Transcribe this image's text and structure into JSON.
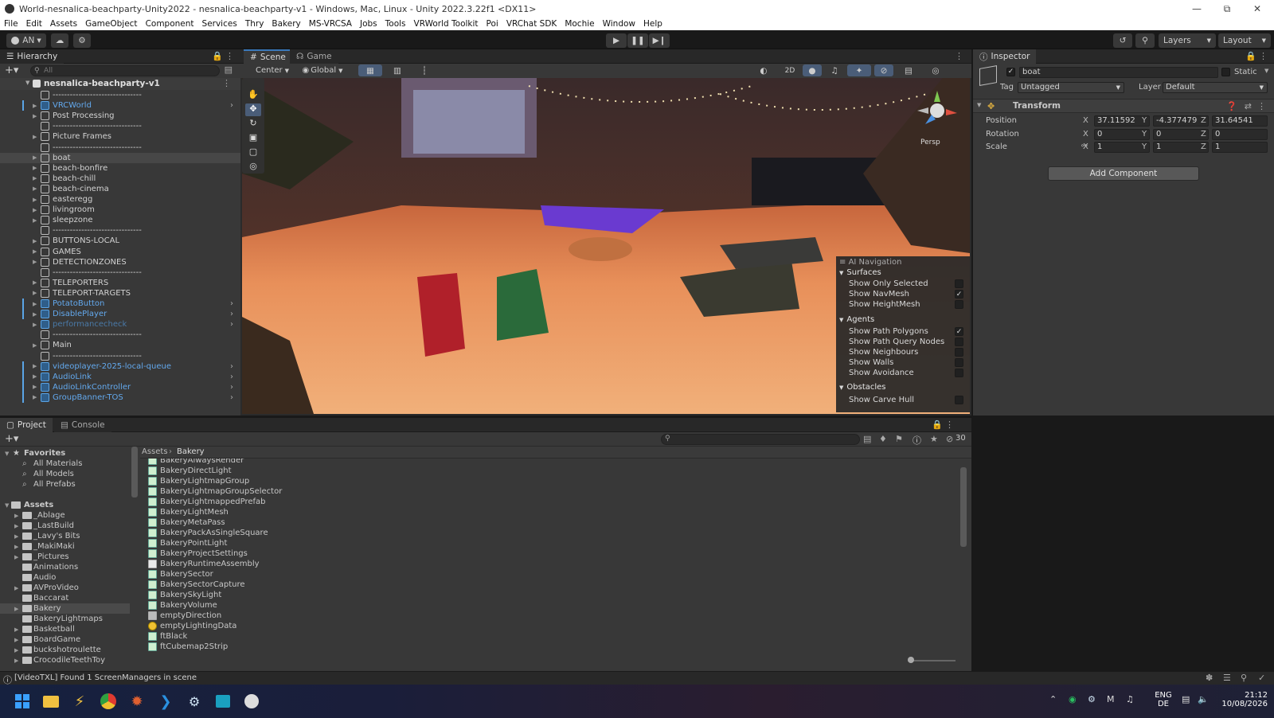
{
  "window": {
    "title": "World-nesnalica-beachparty-Unity2022 - nesnalica-beachparty-v1 - Windows, Mac, Linux - Unity 2022.3.22f1 <DX11>"
  },
  "menu": [
    "File",
    "Edit",
    "Assets",
    "GameObject",
    "Component",
    "Services",
    "Thry",
    "Bakery",
    "MS-VRCSA",
    "Jobs",
    "Tools",
    "VRWorld Toolkit",
    "Poi",
    "VRChat SDK",
    "Mochie",
    "Window",
    "Help"
  ],
  "toolbar": {
    "account": "AN",
    "layers": "Layers",
    "layout": "Layout"
  },
  "hierarchy": {
    "tab": "Hierarchy",
    "search_placeholder": "All",
    "scene_name": "nesnalica-beachparty-v1",
    "items": [
      {
        "label": "-------------------------------",
        "type": "sep"
      },
      {
        "label": "VRCWorld",
        "type": "prefab",
        "chev": true
      },
      {
        "label": "Post Processing",
        "type": "normal"
      },
      {
        "label": "-------------------------------",
        "type": "sep"
      },
      {
        "label": "Picture Frames",
        "type": "normal"
      },
      {
        "label": "-------------------------------",
        "type": "sep"
      },
      {
        "label": "boat",
        "type": "normal",
        "selected": true
      },
      {
        "label": "beach-bonfire",
        "type": "normal"
      },
      {
        "label": "beach-chill",
        "type": "normal"
      },
      {
        "label": "beach-cinema",
        "type": "normal"
      },
      {
        "label": "easteregg",
        "type": "normal"
      },
      {
        "label": "livingroom",
        "type": "normal"
      },
      {
        "label": "sleepzone",
        "type": "normal"
      },
      {
        "label": "-------------------------------",
        "type": "sep"
      },
      {
        "label": "BUTTONS-LOCAL",
        "type": "normal"
      },
      {
        "label": "GAMES",
        "type": "normal"
      },
      {
        "label": "DETECTIONZONES",
        "type": "normal"
      },
      {
        "label": "-------------------------------",
        "type": "sep"
      },
      {
        "label": "TELEPORTERS",
        "type": "normal"
      },
      {
        "label": "TELEPORT-TARGETS",
        "type": "normal"
      },
      {
        "label": "PotatoButton",
        "type": "prefab",
        "chev": true
      },
      {
        "label": "DisablePlayer",
        "type": "prefab",
        "chev": true
      },
      {
        "label": "performancecheck",
        "type": "faded",
        "chev": true
      },
      {
        "label": "-------------------------------",
        "type": "sep"
      },
      {
        "label": "Main",
        "type": "normal"
      },
      {
        "label": "-------------------------------",
        "type": "sep"
      },
      {
        "label": "videoplayer-2025-local-queue",
        "type": "prefab",
        "chev": true
      },
      {
        "label": "AudioLink",
        "type": "prefab",
        "chev": true
      },
      {
        "label": "AudioLinkController",
        "type": "prefab",
        "chev": true
      },
      {
        "label": "GroupBanner-TOS",
        "type": "prefab",
        "chev": true
      }
    ]
  },
  "scene": {
    "tabs": [
      "Scene",
      "Game"
    ],
    "pivot": "Center",
    "space": "Global",
    "mode2d": "2D",
    "gizmo_label": "Persp",
    "ai_nav": {
      "title": "AI Navigation",
      "surfaces": "Surfaces",
      "surface_opts": [
        {
          "label": "Show Only Selected",
          "checked": false
        },
        {
          "label": "Show NavMesh",
          "checked": true
        },
        {
          "label": "Show HeightMesh",
          "checked": false
        }
      ],
      "agents": "Agents",
      "agent_opts": [
        {
          "label": "Show Path Polygons",
          "checked": true
        },
        {
          "label": "Show Path Query Nodes",
          "checked": false
        },
        {
          "label": "Show Neighbours",
          "checked": false
        },
        {
          "label": "Show Walls",
          "checked": false
        },
        {
          "label": "Show Avoidance",
          "checked": false
        }
      ],
      "obstacles": "Obstacles",
      "obstacle_opts": [
        {
          "label": "Show Carve Hull",
          "checked": false
        }
      ]
    }
  },
  "inspector": {
    "tab": "Inspector",
    "object_name": "boat",
    "static_label": "Static",
    "tag_label": "Tag",
    "tag_value": "Untagged",
    "layer_label": "Layer",
    "layer_value": "Default",
    "component": "Transform",
    "position": {
      "label": "Position",
      "x": "37.11592",
      "y": "-4.377479",
      "z": "31.64541"
    },
    "rotation": {
      "label": "Rotation",
      "x": "0",
      "y": "0",
      "z": "0"
    },
    "scale": {
      "label": "Scale",
      "x": "1",
      "y": "1",
      "z": "1"
    },
    "add_component": "Add Component"
  },
  "project": {
    "tabs": [
      "Project",
      "Console"
    ],
    "hidden_count": "30",
    "favorites": "Favorites",
    "fav_items": [
      "All Materials",
      "All Models",
      "All Prefabs"
    ],
    "assets": "Assets",
    "folders": [
      "_Ablage",
      "_LastBuild",
      "_Lavy's Bits",
      "_MakiMaki",
      "_Pictures",
      "Animations",
      "Audio",
      "AVProVideo",
      "Baccarat",
      "Bakery",
      "BakeryLightmaps",
      "Basketball",
      "BoardGame",
      "buckshotroulette",
      "CrocodileTeethToy"
    ],
    "selected_folder": "Bakery",
    "breadcrumb": [
      "Assets",
      "Bakery"
    ],
    "files": [
      {
        "name": "BakeryAlwaysRender",
        "icon": "sc"
      },
      {
        "name": "BakeryDirectLight",
        "icon": "sc"
      },
      {
        "name": "BakeryLightmapGroup",
        "icon": "sc"
      },
      {
        "name": "BakeryLightmapGroupSelector",
        "icon": "sc"
      },
      {
        "name": "BakeryLightmappedPrefab",
        "icon": "sc"
      },
      {
        "name": "BakeryLightMesh",
        "icon": "sc"
      },
      {
        "name": "BakeryMetaPass",
        "icon": "sc"
      },
      {
        "name": "BakeryPackAsSingleSquare",
        "icon": "sc"
      },
      {
        "name": "BakeryPointLight",
        "icon": "sc"
      },
      {
        "name": "BakeryProjectSettings",
        "icon": "sc"
      },
      {
        "name": "BakeryRuntimeAssembly",
        "icon": "fi"
      },
      {
        "name": "BakerySector",
        "icon": "sc"
      },
      {
        "name": "BakerySectorCapture",
        "icon": "sc"
      },
      {
        "name": "BakerySkyLight",
        "icon": "sc"
      },
      {
        "name": "BakeryVolume",
        "icon": "sc"
      },
      {
        "name": "emptyDirection",
        "icon": "gr"
      },
      {
        "name": "emptyLightingData",
        "icon": "lt"
      },
      {
        "name": "ftBlack",
        "icon": "sc"
      },
      {
        "name": "ftCubemap2Strip",
        "icon": "sc"
      }
    ]
  },
  "status": {
    "message": "[VideoTXL] Found 1 ScreenManagers in scene"
  },
  "taskbar": {
    "lang1": "ENG",
    "lang2": "DE",
    "time": "21:12",
    "date": "10/08/2026"
  }
}
